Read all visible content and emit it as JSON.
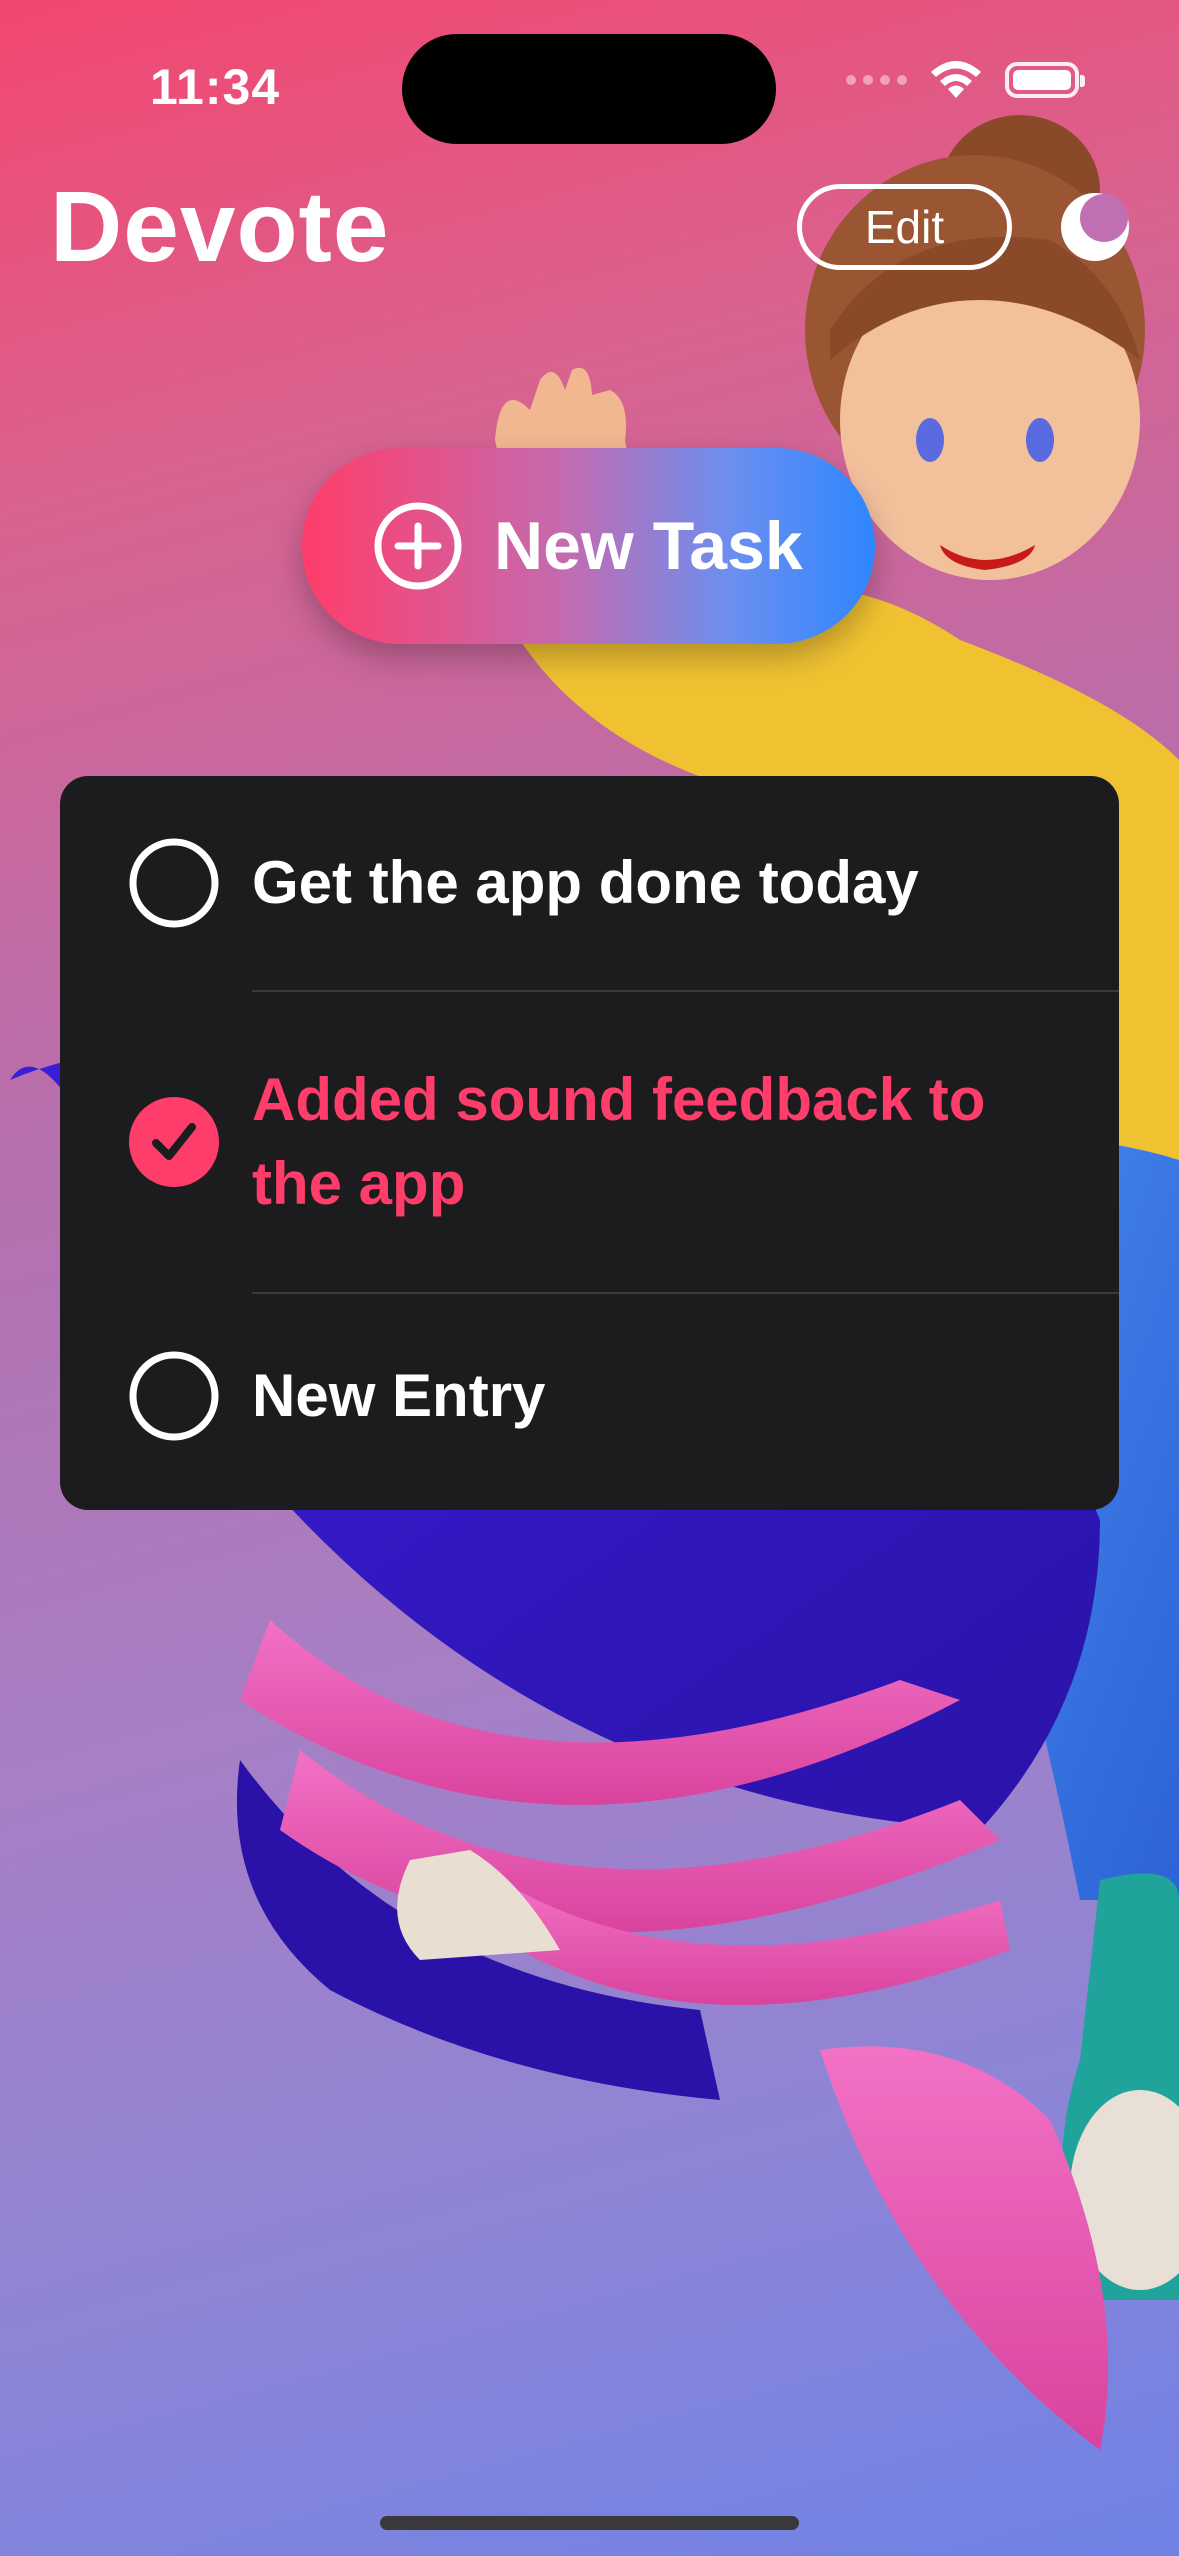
{
  "status_bar": {
    "time": "11:34"
  },
  "header": {
    "title": "Devote",
    "edit_label": "Edit",
    "theme_icon": "moon-icon"
  },
  "new_task": {
    "label": "New Task",
    "icon": "plus-circle-icon"
  },
  "tasks": [
    {
      "text": "Get the app done today",
      "completed": false
    },
    {
      "text": "Added sound feedback to the app",
      "completed": true
    },
    {
      "text": "New Entry",
      "completed": false
    }
  ],
  "colors": {
    "accent": "#ff3d6a",
    "list_background": "#1c1c1e",
    "button_gradient_start": "#ff3d6a",
    "button_gradient_end": "#2f86ff"
  }
}
